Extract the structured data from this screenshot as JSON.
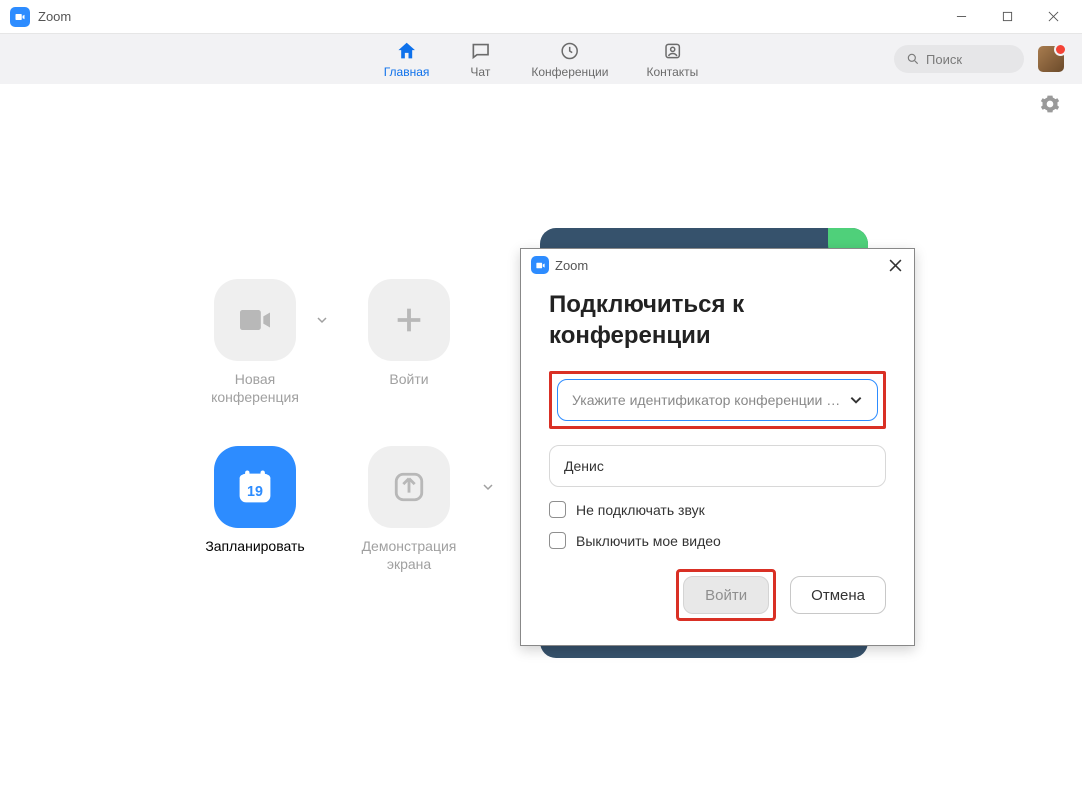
{
  "window": {
    "title": "Zoom"
  },
  "nav": {
    "items": [
      {
        "label": "Главная"
      },
      {
        "label": "Чат"
      },
      {
        "label": "Конференции"
      },
      {
        "label": "Контакты"
      }
    ]
  },
  "search": {
    "placeholder": "Поиск"
  },
  "tiles": {
    "new_meeting": "Новая конференция",
    "join": "Войти",
    "schedule": "Запланировать",
    "share": "Демонстрация экрана",
    "calendar_day": "19"
  },
  "modal": {
    "window_title": "Zoom",
    "title": "Подключиться к конференции",
    "id_placeholder": "Укажите идентификатор конференции …",
    "name_value": "Денис",
    "opt_no_audio": "Не подключать звук",
    "opt_no_video": "Выключить мое видео",
    "btn_join": "Войти",
    "btn_cancel": "Отмена"
  }
}
